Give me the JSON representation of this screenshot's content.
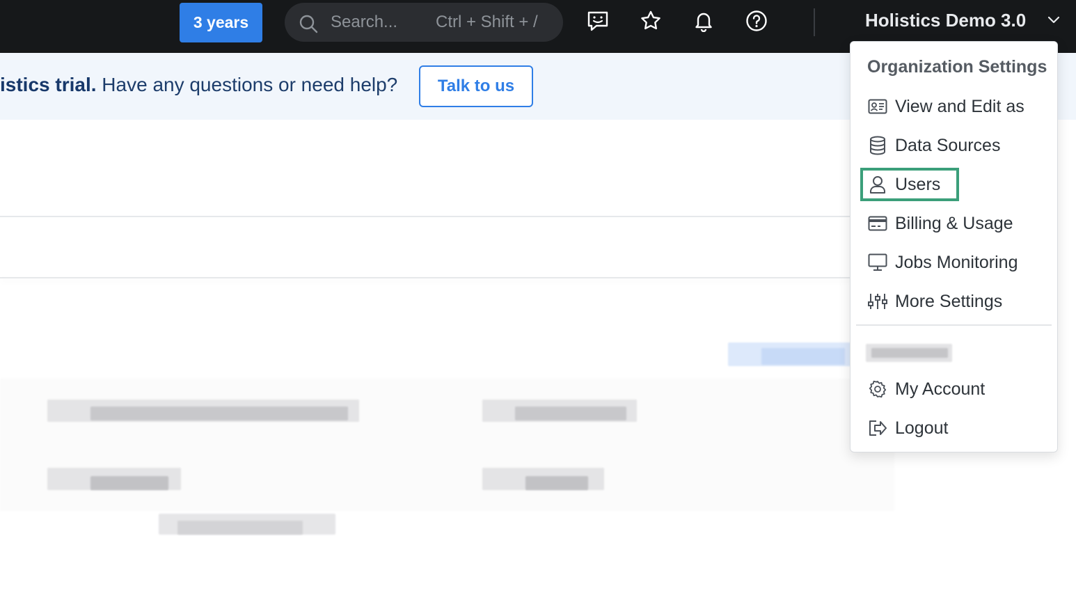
{
  "topbar": {
    "trial_label": "3 years",
    "search_placeholder": "Search...",
    "search_shortcut": "Ctrl + Shift + /",
    "org_name": "Holistics Demo 3.0"
  },
  "banner": {
    "bold_text": "istics trial.",
    "text": " Have any questions or need help?",
    "cta_label": "Talk to us"
  },
  "menu": {
    "title": "Organization Settings",
    "items": [
      {
        "label": "View and Edit as",
        "icon": "id-card-icon"
      },
      {
        "label": "Data Sources",
        "icon": "database-icon"
      },
      {
        "label": "Users",
        "icon": "user-icon",
        "highlighted": true
      },
      {
        "label": "Billing & Usage",
        "icon": "credit-card-icon"
      },
      {
        "label": "Jobs Monitoring",
        "icon": "monitor-icon"
      },
      {
        "label": "More Settings",
        "icon": "sliders-icon"
      }
    ],
    "account_items": [
      {
        "label": "My Account",
        "icon": "gear-icon"
      },
      {
        "label": "Logout",
        "icon": "logout-icon"
      }
    ]
  },
  "colors": {
    "topbar_bg": "#16181a",
    "accent": "#2f7ee6",
    "banner_bg": "#f1f6fc",
    "highlight": "#3b9f7a"
  }
}
